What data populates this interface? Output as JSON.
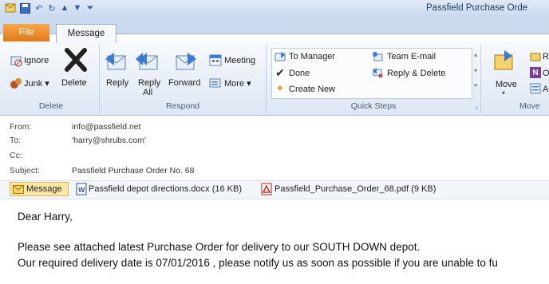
{
  "window": {
    "title": "Passfield Purchase Orde"
  },
  "tabs": {
    "file": "File",
    "message": "Message"
  },
  "ribbon": {
    "delete_group": {
      "label": "Delete",
      "ignore": "Ignore",
      "junk": "Junk",
      "delete": "Delete"
    },
    "respond_group": {
      "label": "Respond",
      "reply": "Reply",
      "reply_all_1": "Reply",
      "reply_all_2": "All",
      "forward": "Forward",
      "meeting": "Meeting",
      "more": "More"
    },
    "quick_steps": {
      "label": "Quick Steps",
      "to_manager": "To Manager",
      "done": "Done",
      "create_new": "Create New",
      "team_email": "Team E-mail",
      "reply_delete": "Reply & Delete"
    },
    "move_group": {
      "label": "Move",
      "move": "Move",
      "rules": "R",
      "onenote": "O",
      "actions": "A"
    }
  },
  "message": {
    "from_label": "From:",
    "from": "info@passfield.net",
    "to_label": "To:",
    "to": "'harry@shrubs.com'",
    "cc_label": "Cc:",
    "cc": "",
    "subject_label": "Subject:",
    "subject": "Passfield Purchase Order No. 68"
  },
  "attachments": {
    "message_tab": "Message",
    "items": [
      {
        "name": "Passfield depot directions.docx (16 KB)"
      },
      {
        "name": "Passfield_Purchase_Order_68.pdf (9 KB)"
      }
    ]
  },
  "body": {
    "greeting": "Dear Harry,",
    "line1": "Please see attached latest Purchase Order for delivery to our SOUTH DOWN depot.",
    "line2": "Our required delivery date is 07/01/2016 , please notify us as soon as possible if you are unable to fu"
  },
  "colors": {
    "file_tab": "#e8801e",
    "ribbon_bg": "#dde7f3",
    "accent": "#2c5aa0"
  }
}
